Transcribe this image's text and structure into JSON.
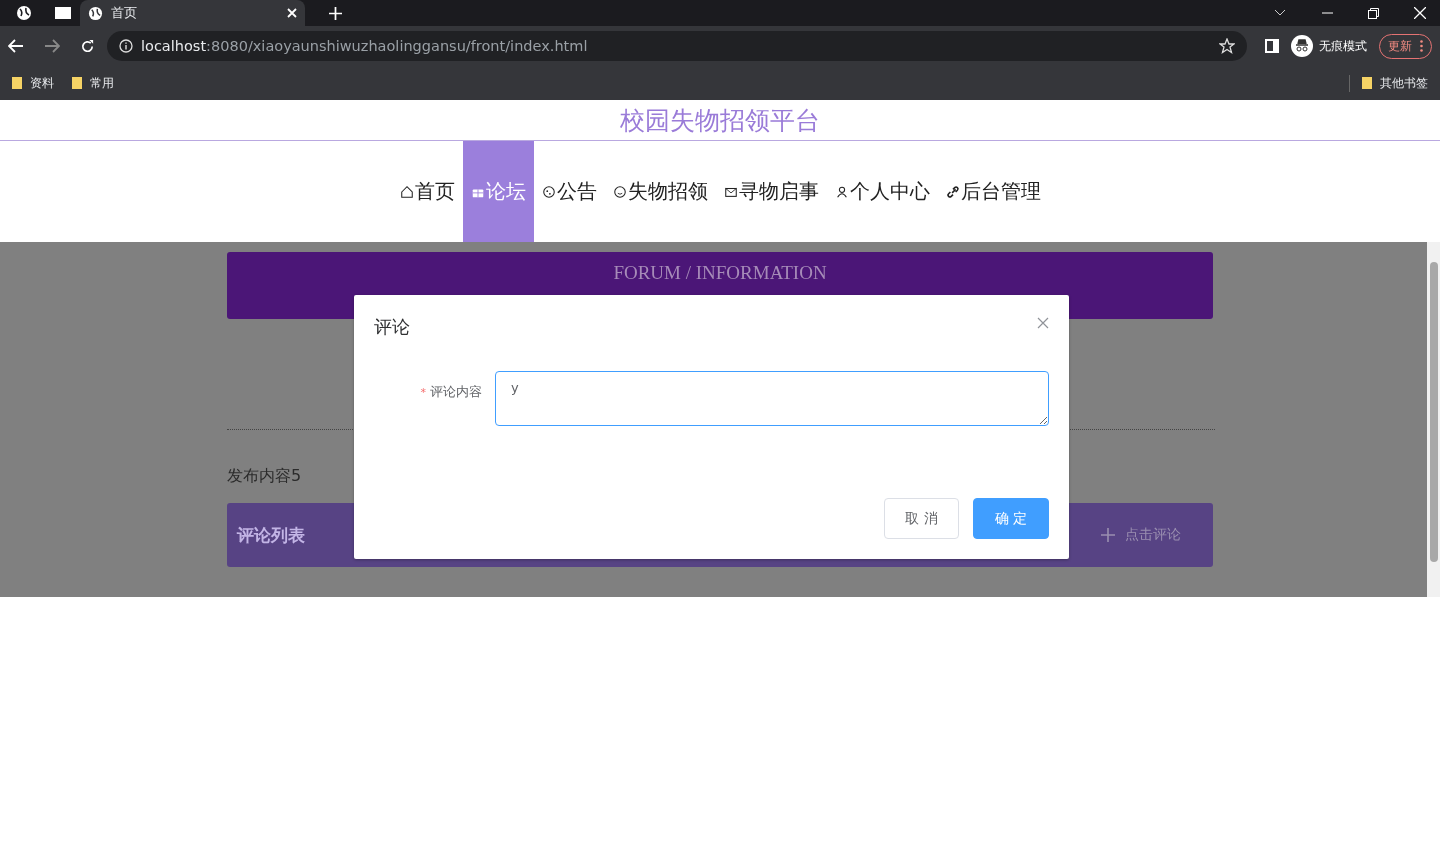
{
  "browser": {
    "tabs": [
      {
        "title": "首页",
        "selected": true
      }
    ],
    "url_host": "localhost",
    "url_path": ":8080/xiaoyaunshiwuzhaolinggansu/front/index.html",
    "profile": "无痕模式",
    "update_button": "更新",
    "bookmarks": [
      "资料",
      "常用"
    ],
    "other_bookmarks": "其他书签"
  },
  "site": {
    "title": "校园失物招领平台",
    "nav": [
      {
        "label": "首页",
        "kind": "home",
        "selected": false
      },
      {
        "label": "论坛",
        "kind": "forum",
        "selected": true
      },
      {
        "label": "公告",
        "kind": "notice",
        "selected": false
      },
      {
        "label": "失物招领",
        "kind": "found",
        "selected": false
      },
      {
        "label": "寻物启事",
        "kind": "lost",
        "selected": false
      },
      {
        "label": "个人中心",
        "kind": "user",
        "selected": false
      },
      {
        "label": "后台管理",
        "kind": "admin",
        "selected": false
      }
    ]
  },
  "forum": {
    "banner_title": "FORUM / INFORMATION",
    "post_title": "发布内容5",
    "comments_label": "评论列表",
    "add_comment": "点击评论"
  },
  "dialog": {
    "title": "评论",
    "field": {
      "label": "评论内容",
      "required_mark": "*",
      "value": "y"
    },
    "buttons": [
      {
        "label": "取 消",
        "kind": "default"
      },
      {
        "label": "确 定",
        "kind": "primary"
      }
    ]
  }
}
